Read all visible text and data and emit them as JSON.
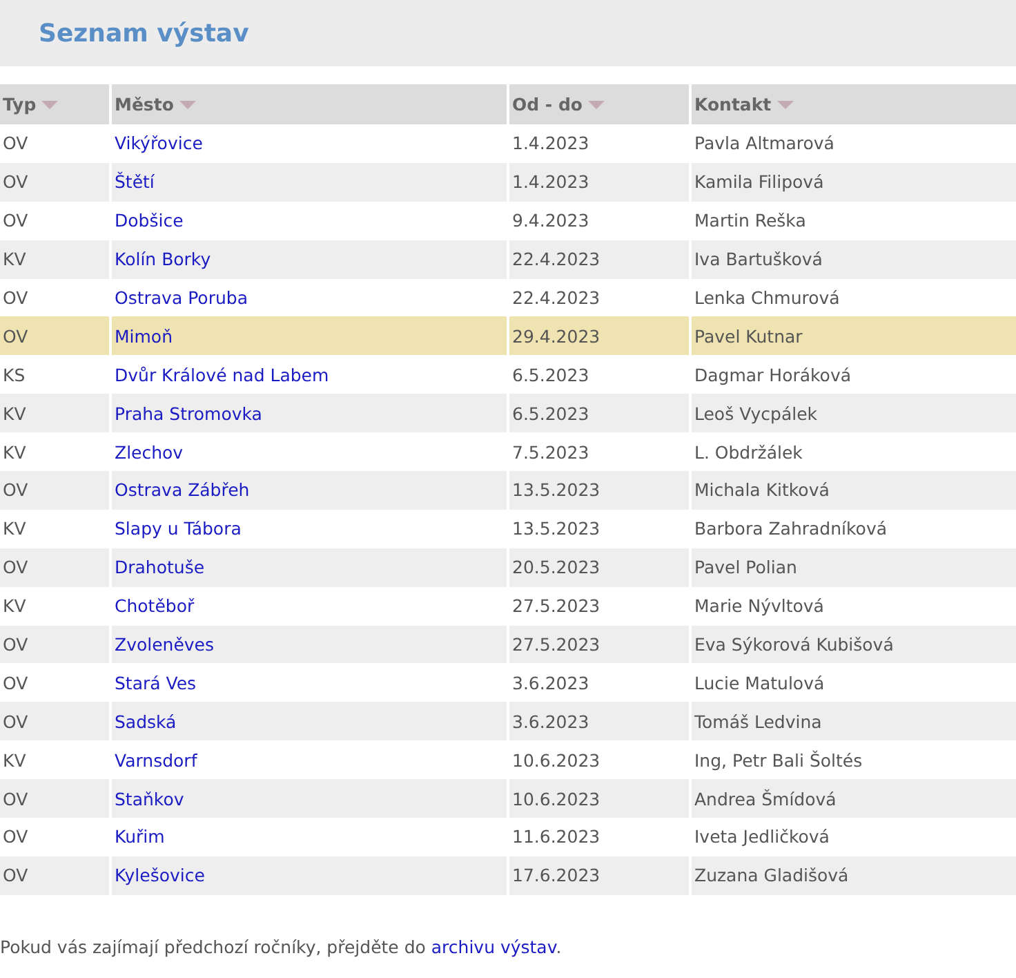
{
  "page": {
    "title": "Seznam výstav"
  },
  "table": {
    "columns": [
      {
        "label": "Typ"
      },
      {
        "label": "Město"
      },
      {
        "label": "Od - do"
      },
      {
        "label": "Kontakt"
      }
    ],
    "rows": [
      {
        "typ": "OV",
        "mesto": "Vikýřovice",
        "datum": "1.4.2023",
        "kontakt": "Pavla Altmarová",
        "selected": false
      },
      {
        "typ": "OV",
        "mesto": "Štětí",
        "datum": "1.4.2023",
        "kontakt": "Kamila Filipová",
        "selected": false
      },
      {
        "typ": "OV",
        "mesto": "Dobšice",
        "datum": "9.4.2023",
        "kontakt": "Martin Reška",
        "selected": false
      },
      {
        "typ": "KV",
        "mesto": "Kolín Borky",
        "datum": "22.4.2023",
        "kontakt": "Iva Bartušková",
        "selected": false
      },
      {
        "typ": "OV",
        "mesto": "Ostrava Poruba",
        "datum": "22.4.2023",
        "kontakt": "Lenka Chmurová",
        "selected": false
      },
      {
        "typ": "OV",
        "mesto": "Mimoň",
        "datum": "29.4.2023",
        "kontakt": "Pavel Kutnar",
        "selected": true
      },
      {
        "typ": "KS",
        "mesto": "Dvůr Králové nad Labem",
        "datum": "6.5.2023",
        "kontakt": "Dagmar Horáková",
        "selected": false
      },
      {
        "typ": "KV",
        "mesto": "Praha Stromovka",
        "datum": "6.5.2023",
        "kontakt": "Leoš Vycpálek",
        "selected": false
      },
      {
        "typ": "KV",
        "mesto": "Zlechov",
        "datum": "7.5.2023",
        "kontakt": "L. Obdržálek",
        "selected": false
      },
      {
        "typ": "OV",
        "mesto": "Ostrava Zábřeh",
        "datum": "13.5.2023",
        "kontakt": "Michala Kitková",
        "selected": false
      },
      {
        "typ": "KV",
        "mesto": "Slapy u Tábora",
        "datum": "13.5.2023",
        "kontakt": "Barbora Zahradníková",
        "selected": false
      },
      {
        "typ": "OV",
        "mesto": "Drahotuše",
        "datum": "20.5.2023",
        "kontakt": "Pavel Polian",
        "selected": false
      },
      {
        "typ": "KV",
        "mesto": "Chotěboř",
        "datum": "27.5.2023",
        "kontakt": "Marie Nývltová",
        "selected": false
      },
      {
        "typ": "OV",
        "mesto": "Zvoleněves",
        "datum": "27.5.2023",
        "kontakt": "Eva Sýkorová Kubišová",
        "selected": false
      },
      {
        "typ": "OV",
        "mesto": "Stará Ves",
        "datum": "3.6.2023",
        "kontakt": "Lucie Matulová",
        "selected": false
      },
      {
        "typ": "OV",
        "mesto": "Sadská",
        "datum": "3.6.2023",
        "kontakt": "Tomáš Ledvina",
        "selected": false
      },
      {
        "typ": "KV",
        "mesto": "Varnsdorf",
        "datum": "10.6.2023",
        "kontakt": "Ing, Petr Bali Šoltés",
        "selected": false
      },
      {
        "typ": "OV",
        "mesto": "Staňkov",
        "datum": "10.6.2023",
        "kontakt": "Andrea Šmídová",
        "selected": false
      },
      {
        "typ": "OV",
        "mesto": "Kuřim",
        "datum": "11.6.2023",
        "kontakt": "Iveta Jedličková",
        "selected": false
      },
      {
        "typ": "OV",
        "mesto": "Kylešovice",
        "datum": "17.6.2023",
        "kontakt": "Zuzana Gladišová",
        "selected": false
      }
    ]
  },
  "footer": {
    "text": "Pokud vás zajímají předchozí ročníky, přejděte do ",
    "link": "archivu výstav",
    "after": "."
  }
}
